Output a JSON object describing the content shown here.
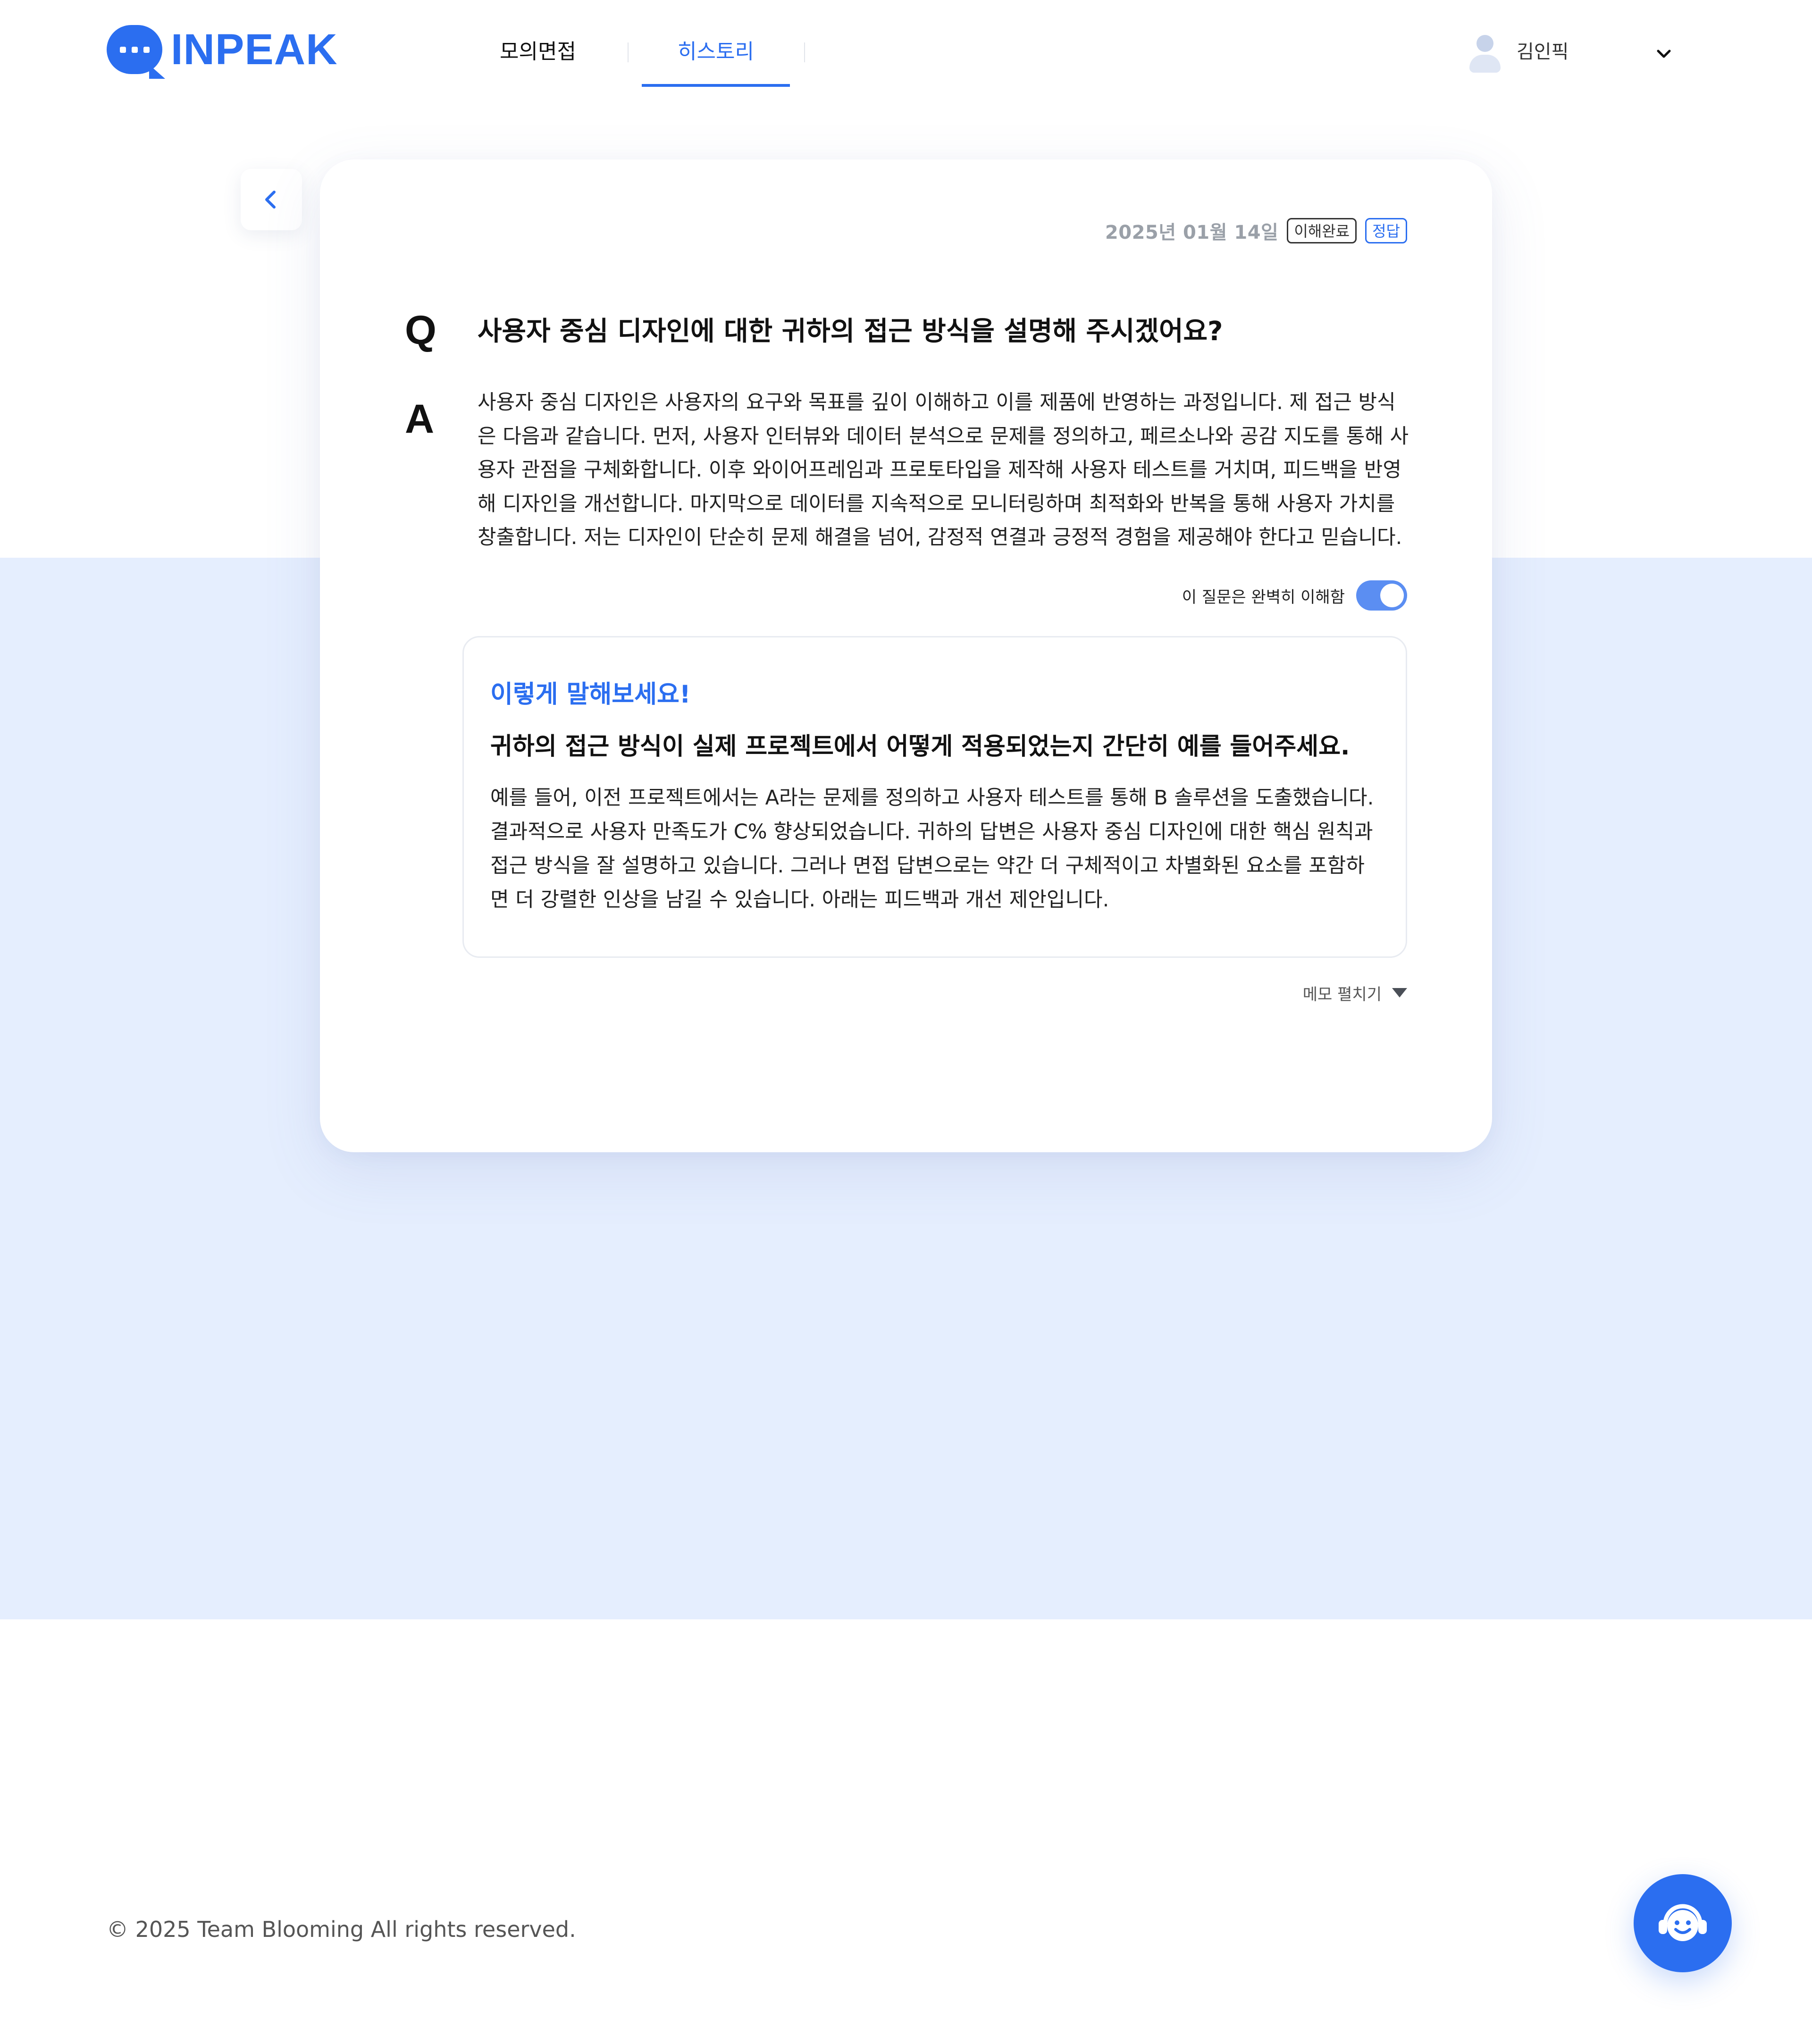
{
  "brand": {
    "logo_text": "INPEAK",
    "accent_color": "#2b6ef0"
  },
  "nav": {
    "items": [
      {
        "label": "모의면접",
        "active": false
      },
      {
        "label": "히스토리",
        "active": true
      }
    ]
  },
  "user": {
    "name": "김인픽",
    "dropdown_icon": "chevron-down-icon"
  },
  "back_button": {
    "icon": "chevron-left-icon"
  },
  "record": {
    "date": "2025년  01월 14일",
    "badges": {
      "understood": "이해완료",
      "correct": "정답"
    },
    "question_marker": "Q",
    "answer_marker": "A",
    "question": "사용자 중심 디자인에 대한 귀하의 접근 방식을 설명해 주시겠어요?",
    "answer_lines": [
      "사용자 중심 디자인은 사용자의 요구와 목표를 깊이 이해하고 이를 제품에 반영하는 과정입니다. 제 접근 방식",
      "은 다음과 같습니다. 먼저, 사용자 인터뷰와 데이터 분석으로 문제를 정의하고, 페르소나와 공감 지도를 통해 사",
      "용자 관점을 구체화합니다. 이후 와이어프레임과 프로토타입을 제작해 사용자 테스트를 거치며, 피드백을 반영",
      "해 디자인을 개선합니다. 마지막으로 데이터를 지속적으로 모니터링하며 최적화와 반복을 통해 사용자 가치를",
      "창출합니다. 저는 디자인이 단순히 문제 해결을 넘어, 감정적 연결과 긍정적 경험을 제공해야 한다고 믿습니다."
    ],
    "understood_toggle": {
      "label": "이 질문은 완벽히 이해함",
      "on": true
    }
  },
  "feedback": {
    "title": "이렇게 말해보세요!",
    "subtitle": "귀하의 접근 방식이 실제 프로젝트에서 어떻게 적용되었는지 간단히 예를 들어주세요.",
    "body_lines": [
      "예를 들어, 이전 프로젝트에서는 A라는 문제를 정의하고 사용자 테스트를 통해 B 솔루션을 도출했습니다.",
      "결과적으로 사용자 만족도가 C% 향상되었습니다. 귀하의 답변은 사용자 중심 디자인에 대한 핵심 원칙과",
      "접근 방식을 잘 설명하고 있습니다. 그러나 면접 답변으로는 약간 더 구체적이고 차별화된 요소를 포함하",
      "면 더 강렬한 인상을 남길 수 있습니다. 아래는 피드백과 개선 제안입니다."
    ]
  },
  "memo": {
    "label": "메모 펼치기",
    "icon": "caret-down-icon"
  },
  "footer": {
    "copyright": "© 2025 Team Blooming All rights reserved."
  },
  "chatbot": {
    "icon": "chatbot-headset-icon"
  },
  "colors": {
    "band_background": "#e5eefe",
    "toggle_on": "#5b8ef2"
  }
}
